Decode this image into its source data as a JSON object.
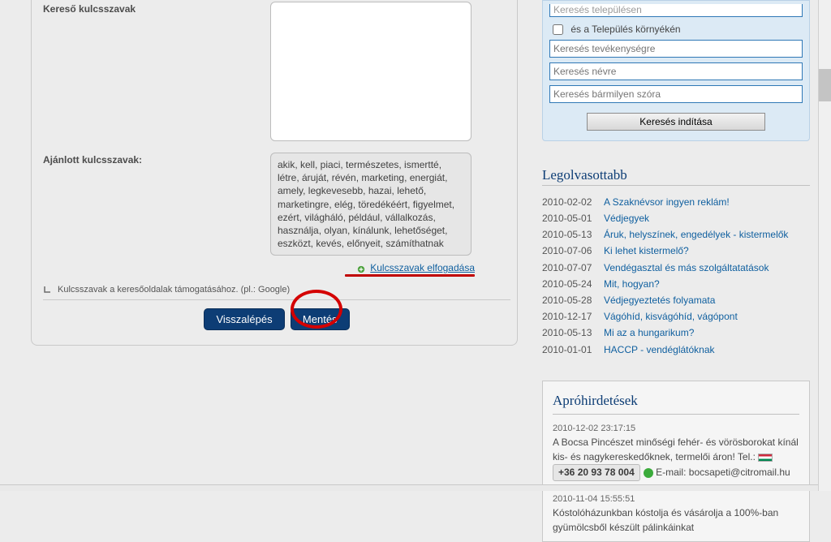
{
  "form": {
    "keyword_label": "Kereső kulcsszavak",
    "suggested_label": "Ajánlott kulcsszavak:",
    "suggested_text": "akik, kell, piaci, természetes, ismertté, létre, áruját, révén, marketing, energiát, amely, legkevesebb, hazai, lehető, marketingre, elég, töredékéért, figyelmet, ezért, világháló, például, vállalkozás, használja, olyan, kínálunk, lehetőséget, eszközt, kevés, előnyeit, számíthatnak",
    "accept_link": "Kulcsszavak elfogadása",
    "hint_text": "Kulcsszavak a keresőoldalak támogatásához. (pl.: Google)",
    "back_btn": "Visszalépés",
    "save_btn": "Mentés"
  },
  "search_box": {
    "top_placeholder_cut": "Keresés településen",
    "surroundings_label": "és a Település környékén",
    "activity_placeholder": "Keresés tevékenységre",
    "name_placeholder": "Keresés névre",
    "anyword_placeholder": "Keresés bármilyen szóra",
    "submit_label": "Keresés indítása"
  },
  "popular_title": "Legolvasottabb",
  "popular": [
    {
      "date": "2010-02-02",
      "title": "A Szaknévsor ingyen reklám!"
    },
    {
      "date": "2010-05-01",
      "title": "Védjegyek"
    },
    {
      "date": "2010-05-13",
      "title": "Áruk, helyszínek, engedélyek - kistermelők"
    },
    {
      "date": "2010-07-06",
      "title": "Ki lehet kistermelő?"
    },
    {
      "date": "2010-07-07",
      "title": "Vendégasztal és más szolgáltatatások"
    },
    {
      "date": "2010-05-24",
      "title": "Mit, hogyan?"
    },
    {
      "date": "2010-05-28",
      "title": "Védjegyeztetés folyamata"
    },
    {
      "date": "2010-12-17",
      "title": "Vágóhíd, kisvágóhíd, vágópont"
    },
    {
      "date": "2010-05-13",
      "title": "Mi az a hungarikum?"
    },
    {
      "date": "2010-01-01",
      "title": "HACCP - vendéglátóknak"
    }
  ],
  "ads_title": "Apróhirdetések",
  "ads": [
    {
      "date": "2010-12-02 23:17:15",
      "text_before": "A Bocsa Pincészet minőségi fehér- és vörösborokat kínál kis- és nagykereskedőknek, termelői áron! Tel.:",
      "phone": "+36 20 93 78 004",
      "text_after": " E-mail: bocsapeti@citromail.hu"
    },
    {
      "date": "2010-11-04 15:55:51",
      "text_before": "Kóstolóházunkban kóstolja és vásárolja a 100%-ban gyümölcsből készült pálinkáinkat"
    }
  ]
}
